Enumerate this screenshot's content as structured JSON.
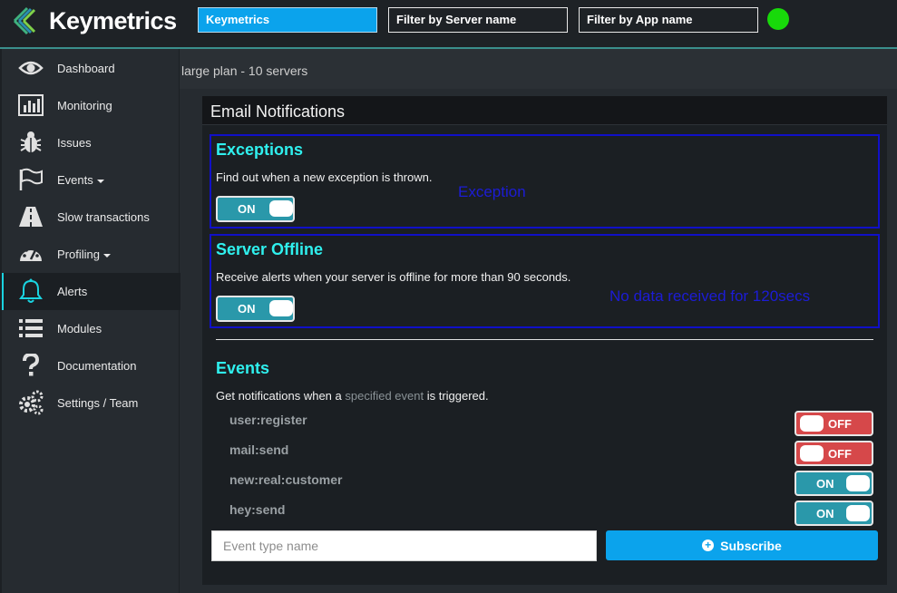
{
  "header": {
    "logo_text": "Keymetrics",
    "filters": [
      {
        "label": "Keymetrics",
        "active": true
      },
      {
        "label": "Filter by Server name",
        "active": false
      },
      {
        "label": "Filter by App name",
        "active": false
      }
    ],
    "status_color": "#18d90a"
  },
  "sidebar": {
    "items": [
      {
        "label": "Dashboard",
        "icon": "eye-icon"
      },
      {
        "label": "Monitoring",
        "icon": "chart-icon"
      },
      {
        "label": "Issues",
        "icon": "bug-icon"
      },
      {
        "label": "Events",
        "icon": "flag-icon",
        "dropdown": true
      },
      {
        "label": "Slow transactions",
        "icon": "road-icon"
      },
      {
        "label": "Profiling",
        "icon": "dashboard-gauge-icon",
        "dropdown": true
      },
      {
        "label": "Alerts",
        "icon": "bell-icon",
        "active": true
      },
      {
        "label": "Modules",
        "icon": "list-icon"
      },
      {
        "label": "Documentation",
        "icon": "question-icon"
      },
      {
        "label": "Settings / Team",
        "icon": "gears-icon"
      }
    ]
  },
  "plan": {
    "text": "large plan - 10 servers"
  },
  "panel": {
    "title": "Email Notifications",
    "exceptions": {
      "title": "Exceptions",
      "desc": "Find out when a new exception is thrown.",
      "toggle": "ON",
      "overlay": "Exception"
    },
    "offline": {
      "title": "Server Offline",
      "desc": "Receive alerts when your server is offline for more than 90 seconds.",
      "toggle": "ON",
      "overlay": "No data received for 120secs"
    },
    "events": {
      "title": "Events",
      "desc_before": "Get notifications when a ",
      "desc_link": "specified event",
      "desc_after": " is triggered.",
      "items": [
        {
          "name": "user:register",
          "state": "OFF"
        },
        {
          "name": "mail:send",
          "state": "OFF"
        },
        {
          "name": "new:real:customer",
          "state": "ON"
        },
        {
          "name": "hey:send",
          "state": "ON"
        }
      ],
      "input_placeholder": "Event type name",
      "subscribe_label": "Subscribe"
    }
  },
  "colors": {
    "accent_cyan": "#2ff0ee",
    "toggle_on": "#2a98aa",
    "toggle_off": "#d6484a",
    "primary_button": "#0ba3ec"
  }
}
